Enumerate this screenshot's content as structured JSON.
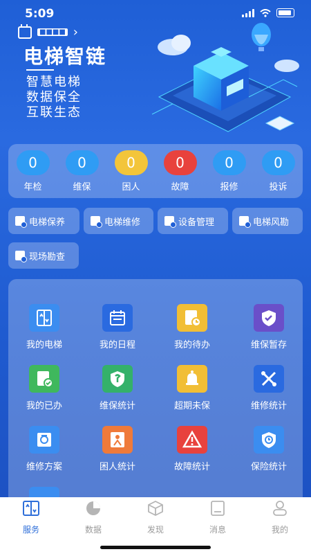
{
  "status": {
    "time": "5:09"
  },
  "header": {
    "date_chip": "■■■■",
    "brand": "电梯智链",
    "slogan": [
      "智慧电梯",
      "数据保全",
      "互联生态"
    ]
  },
  "stats": [
    {
      "value": "0",
      "label": "年检",
      "color": "#2f9cf4"
    },
    {
      "value": "0",
      "label": "维保",
      "color": "#2f9cf4"
    },
    {
      "value": "0",
      "label": "困人",
      "color": "#f3c53a"
    },
    {
      "value": "0",
      "label": "故障",
      "color": "#e8423d"
    },
    {
      "value": "0",
      "label": "报修",
      "color": "#2f9cf4"
    },
    {
      "value": "0",
      "label": "投诉",
      "color": "#2f9cf4"
    }
  ],
  "quick_actions": [
    {
      "label": "电梯保养"
    },
    {
      "label": "电梯维修"
    },
    {
      "label": "设备管理"
    },
    {
      "label": "电梯风勘"
    },
    {
      "label": "现场勘查"
    }
  ],
  "grid": [
    {
      "label": "我的电梯",
      "icon": "elevator-icon",
      "color": "#3b8df0"
    },
    {
      "label": "我的日程",
      "icon": "calendar-icon",
      "color": "#2a6ae0"
    },
    {
      "label": "我的待办",
      "icon": "todo-icon",
      "color": "#f1be35"
    },
    {
      "label": "维保暂存",
      "icon": "shield-check-icon",
      "color": "#6a4fc9"
    },
    {
      "label": "我的已办",
      "icon": "done-icon",
      "color": "#3fb85d"
    },
    {
      "label": "维保统计",
      "icon": "shield-wrench-icon",
      "color": "#34b16a"
    },
    {
      "label": "超期未保",
      "icon": "bell-icon",
      "color": "#f1be35"
    },
    {
      "label": "维修统计",
      "icon": "tools-icon",
      "color": "#2a6ae0"
    },
    {
      "label": "维修方案",
      "icon": "scheme-icon",
      "color": "#3b8df0"
    },
    {
      "label": "困人统计",
      "icon": "trapped-icon",
      "color": "#ef7a3a"
    },
    {
      "label": "故障统计",
      "icon": "warning-icon",
      "color": "#e8423d"
    },
    {
      "label": "保险统计",
      "icon": "insurance-icon",
      "color": "#3b8df0"
    }
  ],
  "tabs": [
    {
      "label": "服务",
      "icon": "service-icon",
      "active": true
    },
    {
      "label": "数据",
      "icon": "pie-chart-icon",
      "active": false
    },
    {
      "label": "发现",
      "icon": "cube-icon",
      "active": false
    },
    {
      "label": "消息",
      "icon": "message-icon",
      "active": false
    },
    {
      "label": "我的",
      "icon": "user-icon",
      "active": false
    }
  ]
}
